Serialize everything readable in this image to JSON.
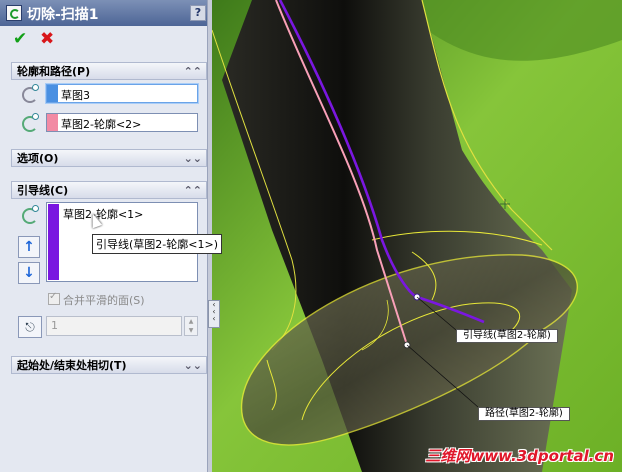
{
  "property_manager": {
    "title": "切除-扫描1",
    "help_icon": "?",
    "ok_icon": "✔",
    "cancel_icon": "✖",
    "sections": {
      "profile_path": {
        "label": "轮廓和路径(P)",
        "profile_value": "草图3",
        "path_value": "草图2-轮廓<2>",
        "profile_swatch_color": "#4a90e2",
        "path_swatch_color": "#f28aa4"
      },
      "options": {
        "label": "选项(O)"
      },
      "guide_curves": {
        "label": "引导线(C)",
        "items": [
          "草图2-轮廓<1>"
        ],
        "tooltip": "引导线(草图2-轮廓<1>)",
        "merge_smooth_faces": "合并平滑的面(S)",
        "count_value": "1",
        "move_up_icon": "↑",
        "move_down_icon": "↓",
        "list_color": "#7a17e0"
      },
      "start_end_tangency": {
        "label": "起始处/结束处相切(T)"
      }
    },
    "collapse_icon": "«",
    "expand_icon": "»"
  },
  "viewport": {
    "callouts": {
      "guide_label": "引导线(草图2-轮廓)",
      "path_label": "路径(草图2-轮廓)"
    },
    "watermark": "三维网www.3dportal.cn"
  }
}
